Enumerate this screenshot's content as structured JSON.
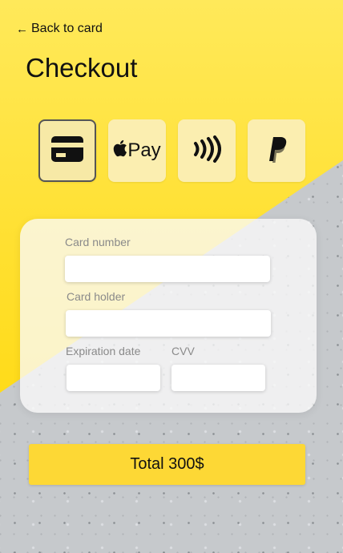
{
  "nav": {
    "back_label": "Back to card"
  },
  "header": {
    "title": "Checkout"
  },
  "payment_methods": [
    {
      "icon": "credit-card-icon",
      "selected": true
    },
    {
      "icon": "apple-pay-icon",
      "label": "Pay",
      "selected": false
    },
    {
      "icon": "contactless-icon",
      "selected": false
    },
    {
      "icon": "paypal-icon",
      "selected": false
    }
  ],
  "form": {
    "card_number_label": "Card number",
    "card_number_value": "",
    "card_holder_label": "Card holder",
    "card_holder_value": "",
    "expiration_label": "Expiration date",
    "expiration_value": "",
    "cvv_label": "CVV",
    "cvv_value": ""
  },
  "total_button_label": "Total 300$",
  "colors": {
    "accent_yellow": "#fdd835",
    "background_yellow": "#ffe030",
    "text": "#111111"
  }
}
